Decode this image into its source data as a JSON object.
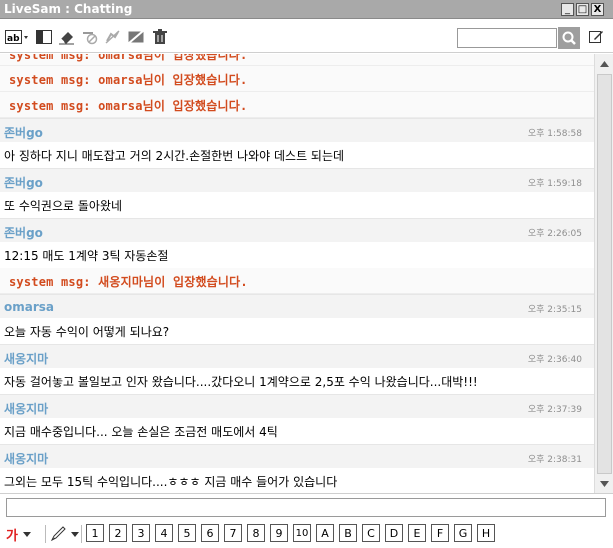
{
  "window": {
    "title": "LiveSam : Chatting",
    "minimize_label": "_",
    "maximize_label": "□",
    "close_label": "X"
  },
  "search": {
    "value": "",
    "placeholder": ""
  },
  "chat": {
    "partial_top_text": "system msg: omarsa님이 입장했습니다.",
    "system_messages": [
      "system msg: omarsa님이 입장했습니다.",
      "system msg: omarsa님이 입장했습니다.",
      "system msg: 새옹지마님이 입장했습니다."
    ],
    "messages": [
      {
        "nick": "존버go",
        "time": "오후 1:58:58",
        "text": "아 징하다 지니 매도잡고 거의 2시간.손절한번 나와야 데스트 되는데"
      },
      {
        "nick": "존버go",
        "time": "오후 1:59:18",
        "text": "또 수익권으로 돌아왔네"
      },
      {
        "nick": "존버go",
        "time": "오후 2:26:05",
        "text": "12:15 매도 1계약 3틱 자동손절"
      },
      {
        "nick": "omarsa",
        "time": "오후 2:35:15",
        "text": "오늘 자동 수익이 어떻게 되나요?"
      },
      {
        "nick": "새옹지마",
        "time": "오후 2:36:40",
        "text": "자동 걸어놓고 볼일보고 인자 왔습니다....갔다오니 1계약으로 2,5포 수익 나왔습니다...대박!!!"
      },
      {
        "nick": "새옹지마",
        "time": "오후 2:37:39",
        "text": "지금 매수중입니다... 오늘 손실은 조금전 매도에서 4틱"
      },
      {
        "nick": "새옹지마",
        "time": "오후 2:38:31",
        "text": "그외는 모두 15틱 수익입니다....ㅎㅎㅎ 지금 매수 들어가 있습니다"
      }
    ]
  },
  "input": {
    "value": "",
    "placeholder": ""
  },
  "bottombar": {
    "font_label": "가",
    "macros": [
      "1",
      "2",
      "3",
      "4",
      "5",
      "6",
      "7",
      "8",
      "9",
      "10",
      "A",
      "B",
      "C",
      "D",
      "E",
      "F",
      "G",
      "H"
    ]
  },
  "icons": {
    "toolbar": [
      "ab-text-size-icon",
      "layout-panel-icon",
      "eraser-icon",
      "block-user-icon",
      "mute-icon",
      "disable-icon",
      "trash-icon",
      "search-icon",
      "edit-icon"
    ]
  },
  "colors": {
    "nick": "#6aa0c8",
    "system": "#d24b1e",
    "font_red": "#e02020"
  }
}
